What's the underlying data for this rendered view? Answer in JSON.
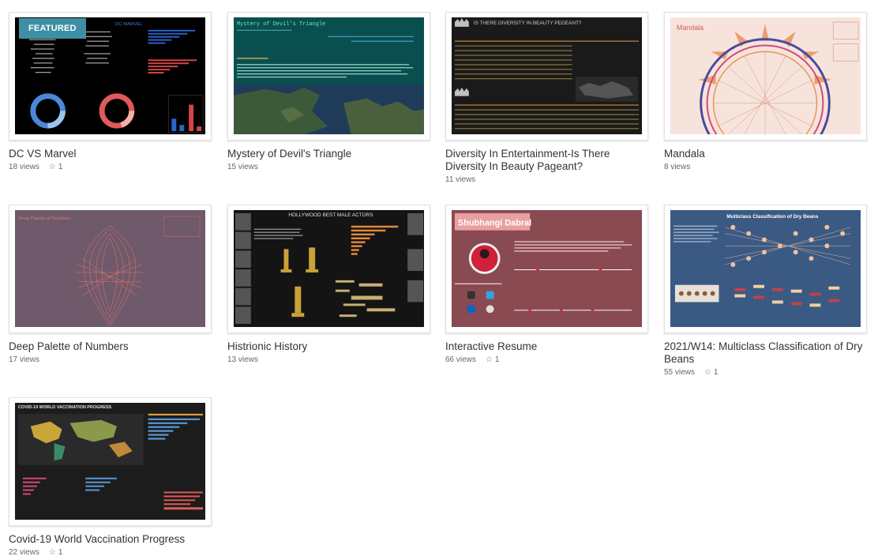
{
  "featured_label": "FEATURED",
  "cards": [
    {
      "title": "DC VS Marvel",
      "views": "18 views",
      "favorites": "1",
      "banner": "DC MARVEL"
    },
    {
      "title": "Mystery of Devil's Triangle",
      "views": "15 views",
      "favorites": "",
      "banner": "Mystery of Devil's Triangle"
    },
    {
      "title": "Diversity In Entertainment-Is There Diversity In Beauty Pageant?",
      "views": "11 views",
      "favorites": "",
      "banner": "IS THERE DIVERSITY IN BEAUTY PEGEANT?"
    },
    {
      "title": "Mandala",
      "views": "8 views",
      "favorites": "",
      "banner": "Mandala"
    },
    {
      "title": "Deep Palette of Numbers",
      "views": "17 views",
      "favorites": "",
      "banner": "Deep Palette of Numbers"
    },
    {
      "title": "Histrionic History",
      "views": "13 views",
      "favorites": "",
      "banner": "HOLLYWOOD BEST MALE ACTORS"
    },
    {
      "title": "Interactive Resume",
      "views": "66 views",
      "favorites": "1",
      "banner": "Shubhangi  Dabral"
    },
    {
      "title": "2021/W14: Multiclass Classification of Dry Beans",
      "views": "55 views",
      "favorites": "1",
      "banner": "Multiclass Classification of Dry Beans"
    },
    {
      "title": "Covid-19 World Vaccination Progress",
      "views": "22 views",
      "favorites": "1",
      "banner": "COVID-19 WORLD VACCINATION PROGRESS"
    }
  ],
  "colors": {
    "featured_badge": "#3d8fa4",
    "devils_bg": "#0a4f4f",
    "mandala_bg": "#f6e4dc",
    "palette_bg": "#6e5a6a",
    "resume_bg": "#8a4a52",
    "beans_bg": "#3a5a84"
  }
}
